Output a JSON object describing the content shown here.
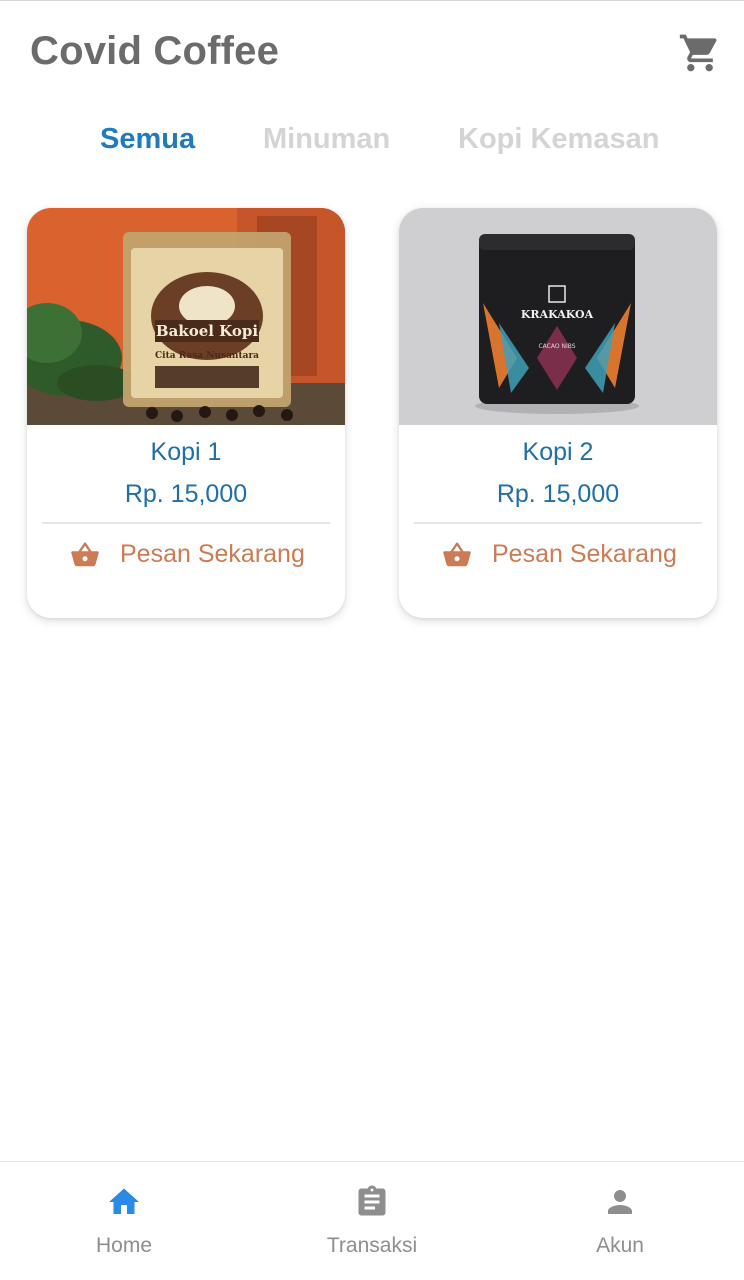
{
  "header": {
    "title": "Covid Coffee",
    "cart_icon": "shopping-cart-icon"
  },
  "tabs": [
    {
      "label": "Semua",
      "active": true
    },
    {
      "label": "Minuman",
      "active": false
    },
    {
      "label": "Kopi Kemasan",
      "active": false
    }
  ],
  "products": [
    {
      "name": "Kopi 1",
      "price": "Rp. 15,000",
      "order_label": "Pesan Sekarang",
      "order_icon": "shopping-basket-icon",
      "image": {
        "brand": "Bakoel Kopi",
        "tagline": "Cita Rasa Nusantara"
      }
    },
    {
      "name": "Kopi 2",
      "price": "Rp. 15,000",
      "order_label": "Pesan Sekarang",
      "order_icon": "shopping-basket-icon",
      "image": {
        "brand": "KRAKAKOA",
        "tagline": "CACAO NIBS"
      }
    }
  ],
  "bottom_nav": [
    {
      "label": "Home",
      "icon": "home-icon",
      "active": true
    },
    {
      "label": "Transaksi",
      "icon": "clipboard-icon",
      "active": false
    },
    {
      "label": "Akun",
      "icon": "person-icon",
      "active": false
    }
  ],
  "colors": {
    "accent": "#1f7bbf",
    "nav_active": "#2b8ae6",
    "order_accent": "#cd7b52",
    "title_gray": "#6b6b6b",
    "inactive_tab": "#d4d4d4"
  }
}
